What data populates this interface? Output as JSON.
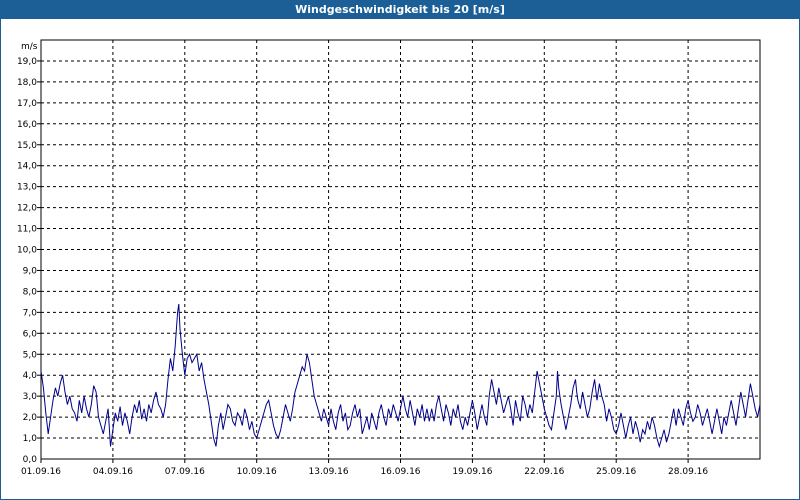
{
  "window": {
    "title": "Windgeschwindigkeit bis 20 [m/s]"
  },
  "colors": {
    "titlebar": "#1c5f96",
    "series": "#00008b",
    "grid": "#000000"
  },
  "chart_data": {
    "type": "line",
    "title": "Windgeschwindigkeit bis 20 [m/s]",
    "ylabel": "m/s",
    "ylim": [
      0,
      20
    ],
    "y_ticks": [
      "1,0",
      "2,0",
      "3,0",
      "4,0",
      "5,0",
      "6,0",
      "7,0",
      "8,0",
      "9,0",
      "10,0",
      "11,0",
      "12,0",
      "13,0",
      "14,0",
      "15,0",
      "16,0",
      "17,0",
      "18,0",
      "19,0"
    ],
    "xlim_days": [
      0,
      30
    ],
    "x_ticks": [
      "01.09.16",
      "04.09.16",
      "07.09.16",
      "10.09.16",
      "13.09.16",
      "16.09.16",
      "19.09.16",
      "22.09.16",
      "25.09.16",
      "28.09.16"
    ],
    "grid": "dashed",
    "series": [
      {
        "points": [
          [
            0,
            4.2
          ],
          [
            0.1,
            3.4
          ],
          [
            0.2,
            2.2
          ],
          [
            0.3,
            1.2
          ],
          [
            0.4,
            2.0
          ],
          [
            0.5,
            2.8
          ],
          [
            0.6,
            3.4
          ],
          [
            0.7,
            3.0
          ],
          [
            0.8,
            3.6
          ],
          [
            0.9,
            4.0
          ],
          [
            1.0,
            3.2
          ],
          [
            1.1,
            2.6
          ],
          [
            1.2,
            3.0
          ],
          [
            1.3,
            2.4
          ],
          [
            1.4,
            2.2
          ],
          [
            1.5,
            1.8
          ],
          [
            1.6,
            2.8
          ],
          [
            1.7,
            2.2
          ],
          [
            1.8,
            3.0
          ],
          [
            1.9,
            2.4
          ],
          [
            2.0,
            2.0
          ],
          [
            2.1,
            2.6
          ],
          [
            2.2,
            3.5
          ],
          [
            2.3,
            3.2
          ],
          [
            2.4,
            2.0
          ],
          [
            2.5,
            1.6
          ],
          [
            2.6,
            1.2
          ],
          [
            2.7,
            1.8
          ],
          [
            2.8,
            2.4
          ],
          [
            2.9,
            0.6
          ],
          [
            3.0,
            1.4
          ],
          [
            3.1,
            2.2
          ],
          [
            3.2,
            1.8
          ],
          [
            3.3,
            2.5
          ],
          [
            3.4,
            1.6
          ],
          [
            3.5,
            2.2
          ],
          [
            3.6,
            1.8
          ],
          [
            3.7,
            1.2
          ],
          [
            3.8,
            2.0
          ],
          [
            3.9,
            2.6
          ],
          [
            4.0,
            2.2
          ],
          [
            4.1,
            2.8
          ],
          [
            4.2,
            1.9
          ],
          [
            4.3,
            2.4
          ],
          [
            4.4,
            1.8
          ],
          [
            4.5,
            2.6
          ],
          [
            4.6,
            2.2
          ],
          [
            4.7,
            2.8
          ],
          [
            4.8,
            3.2
          ],
          [
            4.9,
            2.6
          ],
          [
            5.0,
            2.4
          ],
          [
            5.1,
            2.0
          ],
          [
            5.2,
            2.6
          ],
          [
            5.3,
            3.8
          ],
          [
            5.4,
            4.8
          ],
          [
            5.5,
            4.2
          ],
          [
            5.6,
            5.4
          ],
          [
            5.7,
            7.0
          ],
          [
            5.75,
            7.4
          ],
          [
            5.8,
            6.2
          ],
          [
            5.9,
            5.0
          ],
          [
            6.0,
            4.0
          ],
          [
            6.1,
            4.8
          ],
          [
            6.2,
            5.0
          ],
          [
            6.3,
            4.6
          ],
          [
            6.4,
            4.8
          ],
          [
            6.5,
            5.0
          ],
          [
            6.6,
            4.2
          ],
          [
            6.7,
            4.6
          ],
          [
            6.8,
            3.8
          ],
          [
            6.9,
            3.2
          ],
          [
            7.0,
            2.6
          ],
          [
            7.1,
            1.8
          ],
          [
            7.2,
            1.0
          ],
          [
            7.3,
            0.6
          ],
          [
            7.4,
            1.6
          ],
          [
            7.5,
            2.2
          ],
          [
            7.6,
            1.4
          ],
          [
            7.7,
            2.0
          ],
          [
            7.8,
            2.6
          ],
          [
            7.9,
            2.4
          ],
          [
            8.0,
            1.8
          ],
          [
            8.1,
            1.6
          ],
          [
            8.2,
            2.2
          ],
          [
            8.3,
            2.0
          ],
          [
            8.4,
            1.6
          ],
          [
            8.5,
            2.4
          ],
          [
            8.6,
            2.0
          ],
          [
            8.7,
            1.4
          ],
          [
            8.8,
            1.8
          ],
          [
            8.9,
            1.2
          ],
          [
            9.0,
            1.0
          ],
          [
            9.1,
            1.4
          ],
          [
            9.2,
            1.8
          ],
          [
            9.3,
            2.2
          ],
          [
            9.4,
            2.6
          ],
          [
            9.5,
            2.8
          ],
          [
            9.6,
            2.2
          ],
          [
            9.7,
            1.6
          ],
          [
            9.8,
            1.2
          ],
          [
            9.9,
            1.0
          ],
          [
            10.0,
            1.4
          ],
          [
            10.1,
            2.0
          ],
          [
            10.2,
            2.6
          ],
          [
            10.3,
            2.2
          ],
          [
            10.4,
            1.8
          ],
          [
            10.5,
            2.4
          ],
          [
            10.6,
            3.2
          ],
          [
            10.7,
            3.6
          ],
          [
            10.8,
            4.0
          ],
          [
            10.9,
            4.4
          ],
          [
            11.0,
            4.2
          ],
          [
            11.1,
            5.0
          ],
          [
            11.2,
            4.6
          ],
          [
            11.3,
            3.8
          ],
          [
            11.4,
            3.0
          ],
          [
            11.5,
            2.6
          ],
          [
            11.6,
            2.2
          ],
          [
            11.7,
            1.8
          ],
          [
            11.8,
            2.4
          ],
          [
            11.9,
            2.0
          ],
          [
            12.0,
            1.6
          ],
          [
            12.1,
            2.4
          ],
          [
            12.2,
            1.8
          ],
          [
            12.3,
            1.4
          ],
          [
            12.4,
            2.2
          ],
          [
            12.5,
            2.6
          ],
          [
            12.6,
            1.8
          ],
          [
            12.7,
            2.2
          ],
          [
            12.8,
            1.4
          ],
          [
            12.9,
            1.6
          ],
          [
            13.0,
            2.2
          ],
          [
            13.1,
            2.6
          ],
          [
            13.2,
            2.0
          ],
          [
            13.3,
            2.4
          ],
          [
            13.4,
            1.2
          ],
          [
            13.5,
            1.6
          ],
          [
            13.6,
            2.0
          ],
          [
            13.7,
            1.4
          ],
          [
            13.8,
            2.2
          ],
          [
            13.9,
            1.8
          ],
          [
            14.0,
            1.4
          ],
          [
            14.1,
            2.2
          ],
          [
            14.2,
            2.6
          ],
          [
            14.3,
            2.0
          ],
          [
            14.4,
            1.6
          ],
          [
            14.5,
            2.4
          ],
          [
            14.6,
            2.0
          ],
          [
            14.7,
            2.6
          ],
          [
            14.8,
            2.2
          ],
          [
            14.9,
            1.8
          ],
          [
            15.0,
            2.4
          ],
          [
            15.1,
            3.0
          ],
          [
            15.2,
            2.4
          ],
          [
            15.3,
            2.0
          ],
          [
            15.4,
            2.8
          ],
          [
            15.5,
            2.2
          ],
          [
            15.6,
            1.6
          ],
          [
            15.7,
            2.4
          ],
          [
            15.8,
            2.0
          ],
          [
            15.9,
            2.6
          ],
          [
            16.0,
            1.8
          ],
          [
            16.1,
            2.4
          ],
          [
            16.2,
            1.8
          ],
          [
            16.3,
            2.4
          ],
          [
            16.4,
            1.8
          ],
          [
            16.5,
            2.6
          ],
          [
            16.6,
            3.0
          ],
          [
            16.7,
            2.4
          ],
          [
            16.8,
            1.8
          ],
          [
            16.9,
            2.6
          ],
          [
            17.0,
            2.2
          ],
          [
            17.1,
            1.6
          ],
          [
            17.2,
            2.4
          ],
          [
            17.3,
            2.0
          ],
          [
            17.4,
            2.6
          ],
          [
            17.5,
            1.8
          ],
          [
            17.6,
            1.4
          ],
          [
            17.7,
            2.0
          ],
          [
            17.8,
            1.6
          ],
          [
            17.9,
            2.2
          ],
          [
            18.0,
            2.8
          ],
          [
            18.1,
            2.2
          ],
          [
            18.2,
            1.4
          ],
          [
            18.3,
            2.0
          ],
          [
            18.4,
            2.6
          ],
          [
            18.5,
            2.0
          ],
          [
            18.6,
            1.6
          ],
          [
            18.7,
            3.0
          ],
          [
            18.8,
            3.8
          ],
          [
            18.9,
            3.2
          ],
          [
            19.0,
            2.6
          ],
          [
            19.1,
            3.4
          ],
          [
            19.2,
            2.8
          ],
          [
            19.3,
            2.2
          ],
          [
            19.4,
            2.6
          ],
          [
            19.5,
            3.0
          ],
          [
            19.6,
            2.4
          ],
          [
            19.7,
            1.6
          ],
          [
            19.8,
            2.8
          ],
          [
            19.9,
            2.2
          ],
          [
            20.0,
            1.8
          ],
          [
            20.1,
            3.0
          ],
          [
            20.2,
            2.6
          ],
          [
            20.3,
            2.0
          ],
          [
            20.4,
            2.6
          ],
          [
            20.5,
            2.2
          ],
          [
            20.6,
            3.2
          ],
          [
            20.7,
            4.2
          ],
          [
            20.8,
            3.6
          ],
          [
            20.9,
            3.0
          ],
          [
            21.0,
            2.4
          ],
          [
            21.1,
            2.0
          ],
          [
            21.2,
            1.6
          ],
          [
            21.3,
            1.4
          ],
          [
            21.4,
            2.2
          ],
          [
            21.5,
            3.0
          ],
          [
            21.55,
            4.2
          ],
          [
            21.6,
            3.4
          ],
          [
            21.7,
            2.6
          ],
          [
            21.8,
            2.0
          ],
          [
            21.9,
            1.4
          ],
          [
            22.0,
            2.0
          ],
          [
            22.1,
            2.6
          ],
          [
            22.2,
            3.4
          ],
          [
            22.3,
            3.8
          ],
          [
            22.35,
            3.2
          ],
          [
            22.4,
            2.8
          ],
          [
            22.5,
            2.4
          ],
          [
            22.6,
            3.2
          ],
          [
            22.7,
            2.6
          ],
          [
            22.8,
            2.0
          ],
          [
            22.9,
            2.4
          ],
          [
            23.0,
            3.2
          ],
          [
            23.1,
            3.8
          ],
          [
            23.2,
            2.8
          ],
          [
            23.3,
            3.6
          ],
          [
            23.4,
            3.0
          ],
          [
            23.5,
            2.6
          ],
          [
            23.6,
            1.8
          ],
          [
            23.7,
            2.4
          ],
          [
            23.8,
            2.0
          ],
          [
            23.9,
            1.4
          ],
          [
            24.0,
            1.2
          ],
          [
            24.1,
            1.6
          ],
          [
            24.2,
            2.2
          ],
          [
            24.3,
            1.6
          ],
          [
            24.4,
            1.0
          ],
          [
            24.5,
            1.6
          ],
          [
            24.6,
            2.0
          ],
          [
            24.7,
            1.2
          ],
          [
            24.8,
            1.8
          ],
          [
            24.9,
            1.4
          ],
          [
            25.0,
            0.8
          ],
          [
            25.1,
            1.4
          ],
          [
            25.2,
            1.2
          ],
          [
            25.3,
            1.8
          ],
          [
            25.4,
            1.4
          ],
          [
            25.5,
            2.0
          ],
          [
            25.6,
            1.6
          ],
          [
            25.7,
            1.0
          ],
          [
            25.8,
            0.6
          ],
          [
            25.9,
            1.0
          ],
          [
            26.0,
            1.4
          ],
          [
            26.1,
            0.8
          ],
          [
            26.2,
            1.2
          ],
          [
            26.3,
            1.8
          ],
          [
            26.4,
            2.4
          ],
          [
            26.5,
            1.6
          ],
          [
            26.6,
            2.4
          ],
          [
            26.7,
            2.0
          ],
          [
            26.8,
            1.6
          ],
          [
            26.9,
            2.4
          ],
          [
            27.0,
            2.8
          ],
          [
            27.1,
            2.2
          ],
          [
            27.2,
            1.8
          ],
          [
            27.3,
            2.0
          ],
          [
            27.4,
            2.6
          ],
          [
            27.5,
            2.2
          ],
          [
            27.6,
            1.6
          ],
          [
            27.7,
            2.0
          ],
          [
            27.8,
            2.4
          ],
          [
            27.9,
            1.8
          ],
          [
            28.0,
            1.2
          ],
          [
            28.1,
            1.8
          ],
          [
            28.2,
            2.4
          ],
          [
            28.3,
            1.8
          ],
          [
            28.4,
            1.2
          ],
          [
            28.5,
            2.0
          ],
          [
            28.6,
            1.6
          ],
          [
            28.7,
            2.2
          ],
          [
            28.8,
            2.8
          ],
          [
            28.9,
            2.2
          ],
          [
            29.0,
            1.6
          ],
          [
            29.1,
            2.4
          ],
          [
            29.2,
            3.2
          ],
          [
            29.3,
            2.6
          ],
          [
            29.4,
            2.0
          ],
          [
            29.5,
            2.8
          ],
          [
            29.6,
            3.6
          ],
          [
            29.7,
            3.0
          ],
          [
            29.8,
            2.4
          ],
          [
            29.9,
            2.0
          ],
          [
            30.0,
            2.6
          ]
        ],
        "note_hidden": false
      }
    ]
  }
}
